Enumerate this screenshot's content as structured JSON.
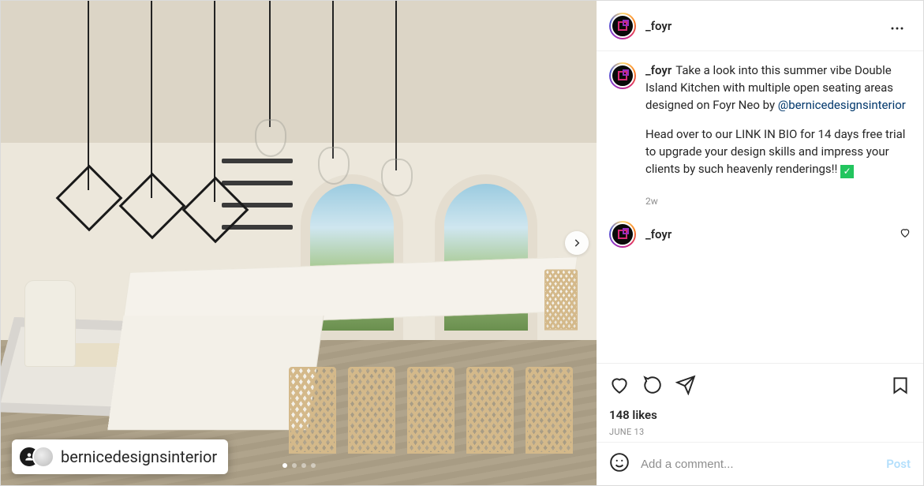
{
  "post": {
    "author_username": "_foyr",
    "caption_p1_prefix": "Take a look into this summer vibe Double Island Kitchen with multiple open seating areas designed on Foyr Neo by ",
    "caption_mention": "@bernicedesignsinterior",
    "caption_p2": "Head over to our LINK IN BIO for 14 days free trial to upgrade your design skills and impress your clients by such heavenly renderings!! ",
    "caption_age": "2w",
    "likes_text": "148 likes",
    "date_text": "JUNE 13",
    "tagged_overlay_name": "bernicedesignsinterior",
    "carousel": {
      "total": 4,
      "active_index": 0
    },
    "visible_comment_username": "_foyr"
  },
  "comment_box": {
    "placeholder": "Add a comment...",
    "submit_label": "Post"
  }
}
